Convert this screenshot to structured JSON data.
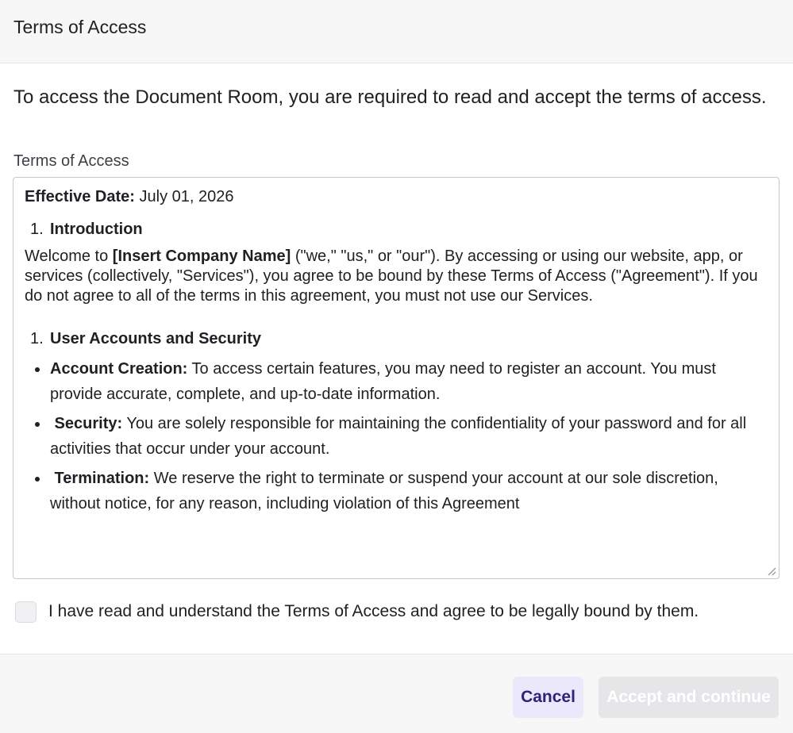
{
  "dialog": {
    "title": "Terms of Access",
    "intro": "To access the Document Room, you are required to read and accept the terms of access.",
    "field_label": "Terms of Access"
  },
  "terms": {
    "effective_label": "Effective Date:",
    "effective_value": "July 01, 2026",
    "section1_num": "1.",
    "section1_title": "Introduction",
    "intro_pre": "Welcome to ",
    "intro_company": "[Insert Company Name]",
    "intro_post": " (\"we,\" \"us,\" or \"our\"). By accessing or using our website, app, or services (collectively, \"Services\"), you agree to be bound by these Terms of Access (\"Agreement\"). If you do not agree to all of the terms in this agreement, you must not use our Services.",
    "section2_num": "1.",
    "section2_title": "User Accounts and Security",
    "bullets": [
      {
        "label": "Account Creation:",
        "text": " To access certain features, you may need to register an account. You must provide accurate, complete, and up-to-date information."
      },
      {
        "label": " Security:",
        "text": " You are solely responsible for maintaining the confidentiality of your password and for all activities that occur under your account."
      },
      {
        "label": " Termination:",
        "text": " We reserve the right to terminate or suspend your account at our sole discretion, without notice, for any reason, including violation of this Agreement"
      }
    ]
  },
  "agree": {
    "checked": false,
    "label": "I have read and understand the Terms of Access and agree to be legally bound by them."
  },
  "buttons": {
    "cancel": "Cancel",
    "accept": "Accept and continue"
  },
  "colors": {
    "cancel_bg": "#ece8fb",
    "cancel_text": "#2e2376",
    "accept_disabled_bg": "#e6e6e9"
  }
}
